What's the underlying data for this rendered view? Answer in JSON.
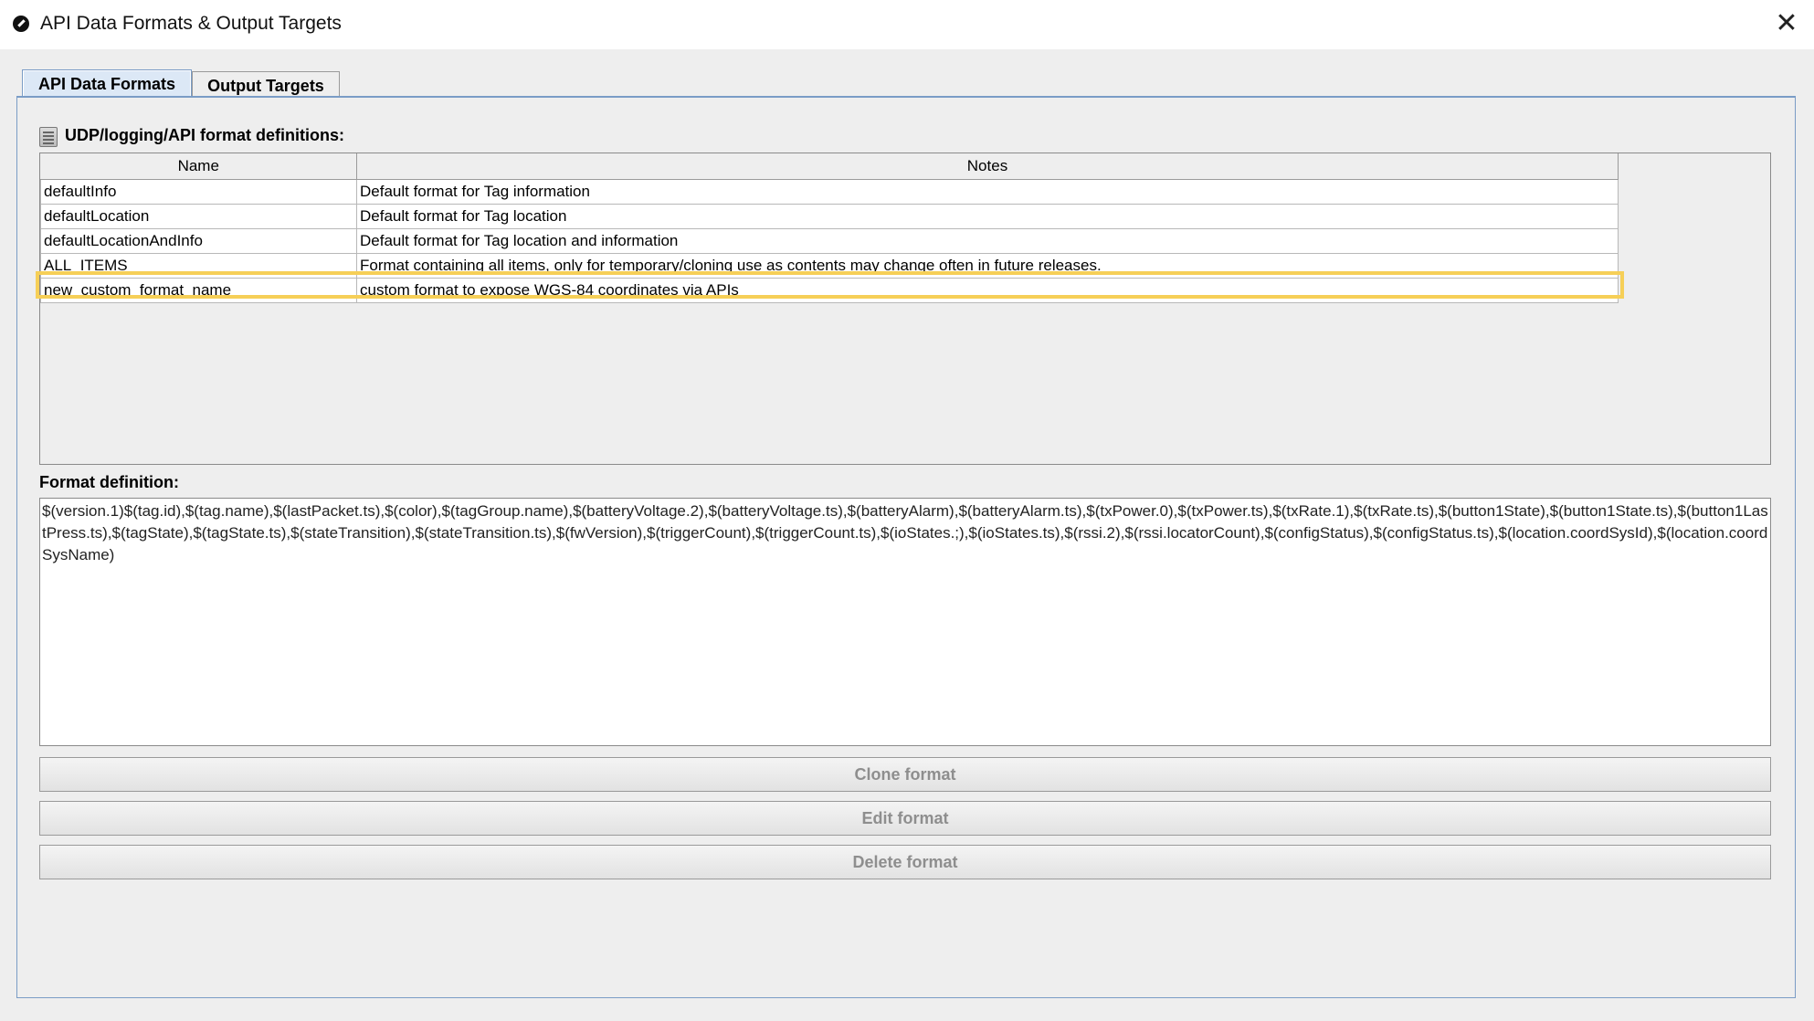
{
  "window": {
    "title": "API Data Formats & Output Targets",
    "close_glyph": "✕"
  },
  "tabs": [
    {
      "label": "API Data Formats",
      "active": true
    },
    {
      "label": "Output Targets",
      "active": false
    }
  ],
  "section": {
    "label": "UDP/logging/API format definitions:",
    "icon": "database-icon"
  },
  "table": {
    "columns": [
      "Name",
      "Notes"
    ],
    "rows": [
      {
        "name": "defaultInfo",
        "notes": "Default format for Tag information"
      },
      {
        "name": "defaultLocation",
        "notes": "Default format for Tag location"
      },
      {
        "name": "defaultLocationAndInfo",
        "notes": "Default format for Tag location and information"
      },
      {
        "name": "ALL_ITEMS",
        "notes": "Format containing all items, only for temporary/cloning use as contents may change often in future releases."
      },
      {
        "name": "new_custom_format_name",
        "notes": "custom format to expose WGS-84 coordinates via APIs"
      }
    ],
    "highlight_color": "#f6cf57"
  },
  "definition": {
    "label": "Format definition:",
    "value": "$(version.1)$(tag.id),$(tag.name),$(lastPacket.ts),$(color),$(tagGroup.name),$(batteryVoltage.2),$(batteryVoltage.ts),$(batteryAlarm),$(batteryAlarm.ts),$(txPower.0),$(txPower.ts),$(txRate.1),$(txRate.ts),$(button1State),$(button1State.ts),$(button1LastPress.ts),$(tagState),$(tagState.ts),$(stateTransition),$(stateTransition.ts),$(fwVersion),$(triggerCount),$(triggerCount.ts),$(ioStates.;),$(ioStates.ts),$(rssi.2),$(rssi.locatorCount),$(configStatus),$(configStatus.ts),$(location.coordSysId),$(location.coordSysName)"
  },
  "buttons": {
    "clone": "Clone format",
    "edit": "Edit format",
    "delete": "Delete format"
  }
}
